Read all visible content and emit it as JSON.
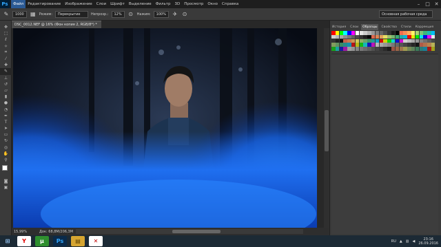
{
  "app": {
    "logo": "Ps",
    "title_tab": "DSC_0012.NEF @ 16% (Фон копия 2, RGB/8*) *"
  },
  "menu": [
    "Файл",
    "Редактирование",
    "Изображение",
    "Слои",
    "Шрифт",
    "Выделение",
    "Фильтр",
    "3D",
    "Просмотр",
    "Окно",
    "Справка"
  ],
  "window_controls": {
    "minimize": "–",
    "maximize": "□",
    "close": "✕"
  },
  "options": {
    "brush_size": "1000",
    "mode_label": "Режим:",
    "mode_value": "Перекрытие",
    "opacity_label": "Непрозр.:",
    "opacity_value": "12%",
    "flow_label": "Нажим:",
    "flow_value": "100%",
    "workspace": "Основная рабочая среда"
  },
  "tools": [
    "move-icon",
    "marquee-icon",
    "lasso-icon",
    "quick-select-icon",
    "crop-icon",
    "eyedropper-icon",
    "healing-icon",
    "brush-icon",
    "stamp-icon",
    "history-brush-icon",
    "eraser-icon",
    "gradient-icon",
    "blur-icon",
    "dodge-icon",
    "pen-icon",
    "type-icon",
    "path-select-icon",
    "shape-icon",
    "3d-rotate-icon",
    "3d-camera-icon",
    "hand-icon",
    "zoom-icon"
  ],
  "status": {
    "zoom": "15,99%",
    "doc_size": "Док: 68,8M/206,3M"
  },
  "panel_tabs": [
    "История",
    "Слои",
    "Образцы",
    "Свойства",
    "Стили",
    "Коррекция"
  ],
  "panel_active": "Образцы",
  "swatch_colors": [
    "#ff0000",
    "#ffff00",
    "#00ff00",
    "#00ffff",
    "#0000ff",
    "#ff00ff",
    "#ffffff",
    "#e6e6e6",
    "#cccccc",
    "#b3b3b3",
    "#999999",
    "#808080",
    "#666666",
    "#4d4d4d",
    "#333333",
    "#1a1a1a",
    "#000000",
    "#f26c4f",
    "#f68e56",
    "#fbaf5d",
    "#fff568",
    "#acd372",
    "#7cc576",
    "#3bb878",
    "#1abbb4",
    "#00bff3"
  ],
  "taskbar": {
    "buttons": [
      {
        "name": "yandex-browser-button",
        "label": "Y",
        "bg": "#ffffff",
        "fg": "#e10000"
      },
      {
        "name": "utorrent-button",
        "label": "µ",
        "bg": "#2f8f2f",
        "fg": "#ffffff"
      },
      {
        "name": "photoshop-button",
        "label": "Ps",
        "bg": "#0a2a4a",
        "fg": "#31a8ff"
      },
      {
        "name": "explorer-button",
        "label": "▤",
        "bg": "#d6a531",
        "fg": "#5a3e00"
      },
      {
        "name": "adobe-reader-button",
        "label": "✕",
        "bg": "#ffffff",
        "fg": "#c00000"
      }
    ],
    "lang": "RU",
    "time": "23:16",
    "date": "26.09.2016"
  }
}
